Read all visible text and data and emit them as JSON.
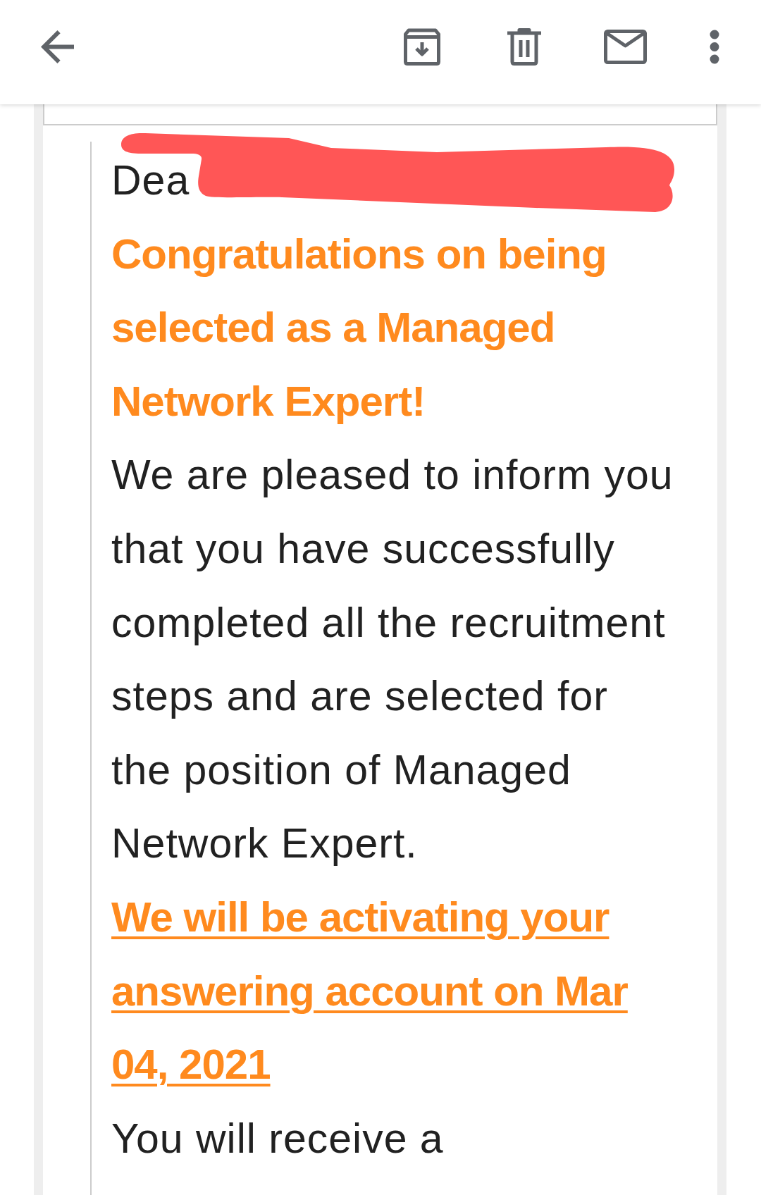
{
  "message": {
    "blocks": [
      {
        "kind": "greeting",
        "text": "Dea",
        "redacted": true
      },
      {
        "kind": "heading",
        "text": "Congratulations on being selected as a Managed Network Expert!"
      },
      {
        "kind": "paragraph",
        "text": "We are pleased to inform you that you have successfully completed all the recruitment steps and are selected for the position of Managed Network Expert."
      },
      {
        "kind": "link",
        "text": "We will be activating your answering account on  Mar 04, 2021"
      },
      {
        "kind": "paragraph",
        "text": "You will receive a"
      }
    ]
  }
}
